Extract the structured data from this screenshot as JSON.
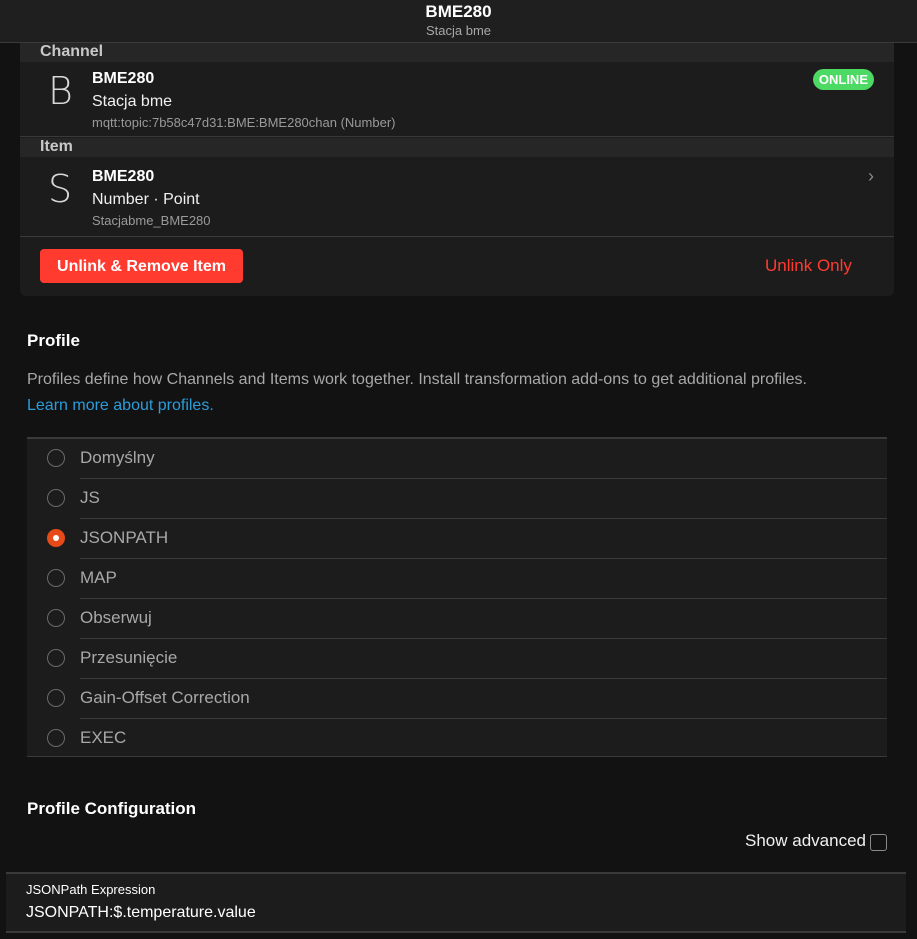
{
  "navbar": {
    "title": "BME280",
    "subtitle": "Stacja bme"
  },
  "channel": {
    "group_label": "Channel",
    "letter": "B",
    "title": "BME280",
    "subtitle": "Stacja bme",
    "footer": "mqtt:topic:7b58c47d31:BME:BME280chan (Number)",
    "status": "ONLINE",
    "status_color": "#4cd964"
  },
  "item": {
    "group_label": "Item",
    "letter": "S",
    "title": "BME280",
    "subtitle": "Number · Point",
    "footer": "Stacjabme_BME280",
    "chevron_icon": "chevron-right-icon"
  },
  "actions": {
    "unlink_remove": "Unlink & Remove Item",
    "unlink_only": "Unlink Only",
    "danger_color": "#ff3b30"
  },
  "profile": {
    "title": "Profile",
    "description": "Profiles define how Channels and Items work together. Install transformation add-ons to get additional profiles.",
    "learn_more": "Learn more about profiles.",
    "selected": "JSONPATH",
    "accent_color": "#e64a19",
    "options": [
      {
        "label": "Domyślny"
      },
      {
        "label": "JS"
      },
      {
        "label": "JSONPATH"
      },
      {
        "label": "MAP"
      },
      {
        "label": "Obserwuj"
      },
      {
        "label": "Przesunięcie"
      },
      {
        "label": "Gain-Offset Correction"
      },
      {
        "label": "EXEC"
      }
    ]
  },
  "config": {
    "title": "Profile Configuration",
    "show_advanced": "Show advanced",
    "show_advanced_checked": false,
    "field_label": "JSONPath Expression",
    "field_value": "JSONPATH:$.temperature.value"
  }
}
